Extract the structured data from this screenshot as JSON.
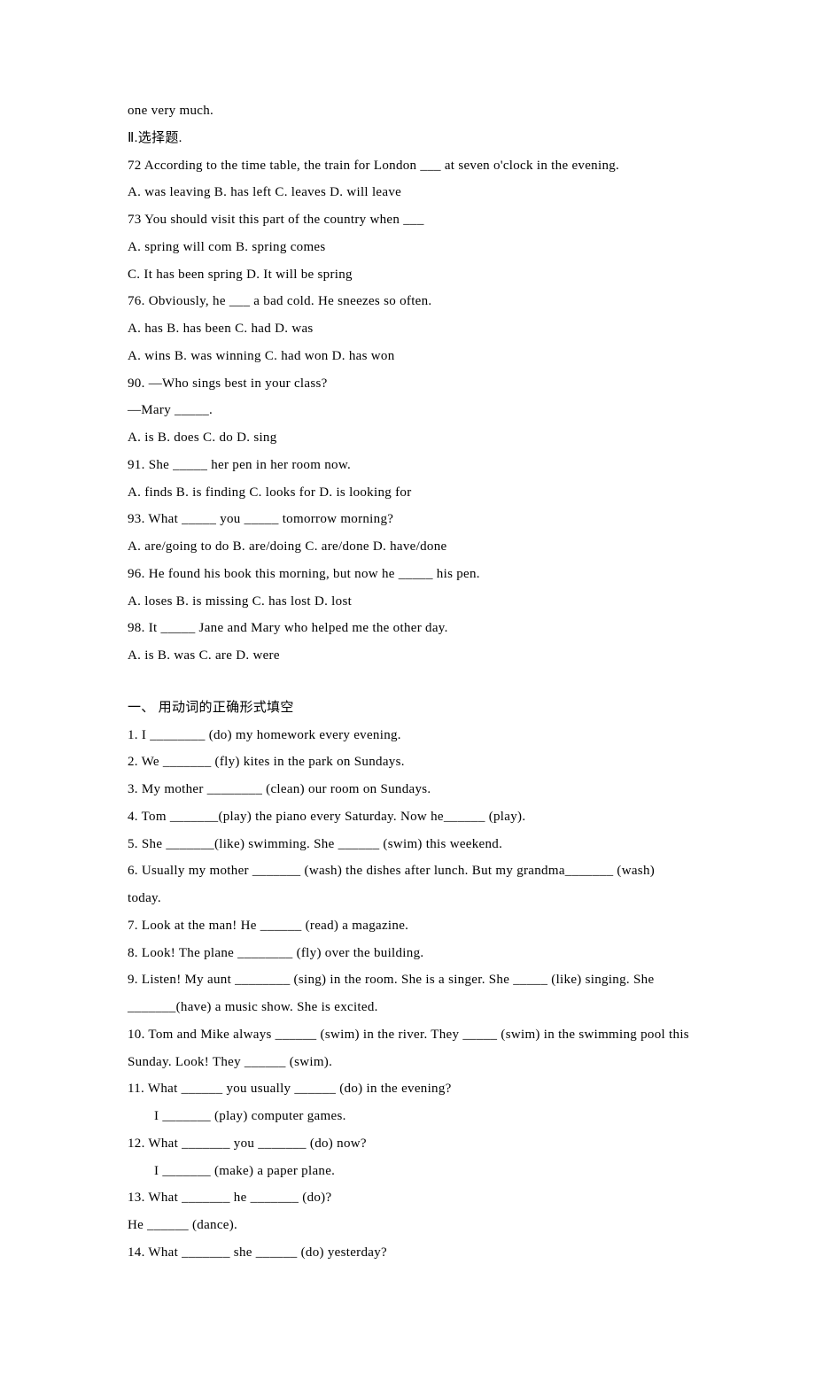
{
  "intro": {
    "line": "one very much."
  },
  "section2": {
    "heading": "Ⅱ.选择题.",
    "items": [
      {
        "q": "72 According to the time table, the train for London ___ at seven o'clock in the evening.",
        "opts": "A. was leaving B. has left C. leaves D. will leave"
      },
      {
        "q": "73 You should visit this part of the country when ___",
        "opts": "A. spring will com B. spring comes",
        "opts2": "C. It has been spring D. It will be spring"
      },
      {
        "q": "76. Obviously, he ___ a bad cold. He sneezes so often.",
        "opts": "A. has B. has been C. had D. was",
        "opts2": "A. wins B. was winning C. had won D. has won"
      },
      {
        "q": "90. —Who sings best in your class?",
        "q2": "—Mary _____.",
        "opts": "A. is B. does C. do D. sing"
      },
      {
        "q": "91. She _____ her pen in her room now.",
        "opts": "A. finds B. is finding C. looks for D. is looking for"
      },
      {
        "q": "93. What _____ you _____ tomorrow morning?",
        "opts": "A. are/going to do B. are/doing C. are/done D. have/done"
      },
      {
        "q": "96. He found his book this morning, but now he _____ his pen.",
        "opts": "A. loses B. is missing C. has lost D. lost"
      },
      {
        "q": "98. It _____ Jane and Mary who helped me the other day.",
        "opts": "A. is B. was C. are D. were"
      }
    ]
  },
  "section3": {
    "heading": "一、 用动词的正确形式填空",
    "items": [
      "1. I ________ (do) my homework every evening.",
      "2. We _______ (fly) kites in the park on Sundays.",
      "3. My mother ________ (clean) our room on Sundays.",
      "4. Tom _______(play) the piano every Saturday. Now he______ (play).",
      "5. She _______(like) swimming. She ______ (swim) this weekend.",
      "6. Usually my mother _______ (wash) the dishes after lunch. But my grandma_______ (wash) today.",
      "7. Look at the man! He ______ (read) a magazine.",
      "8. Look! The plane ________ (fly) over the building.",
      "9. Listen! My aunt ________ (sing) in the room. She is a singer. She _____ (like) singing. She _______(have) a music show. She is excited.",
      "10. Tom and Mike always ______ (swim) in the river. They _____ (swim) in the swimming pool this Sunday. Look! They ______ (swim).",
      "11. What ______ you usually ______ (do) in the evening?",
      "I _______ (play) computer games.",
      "12. What _______ you _______ (do) now?",
      "I _______ (make) a paper plane.",
      "13. What _______ he _______ (do)?",
      "He ______ (dance).",
      "14. What _______ she ______ (do) yesterday?"
    ]
  }
}
